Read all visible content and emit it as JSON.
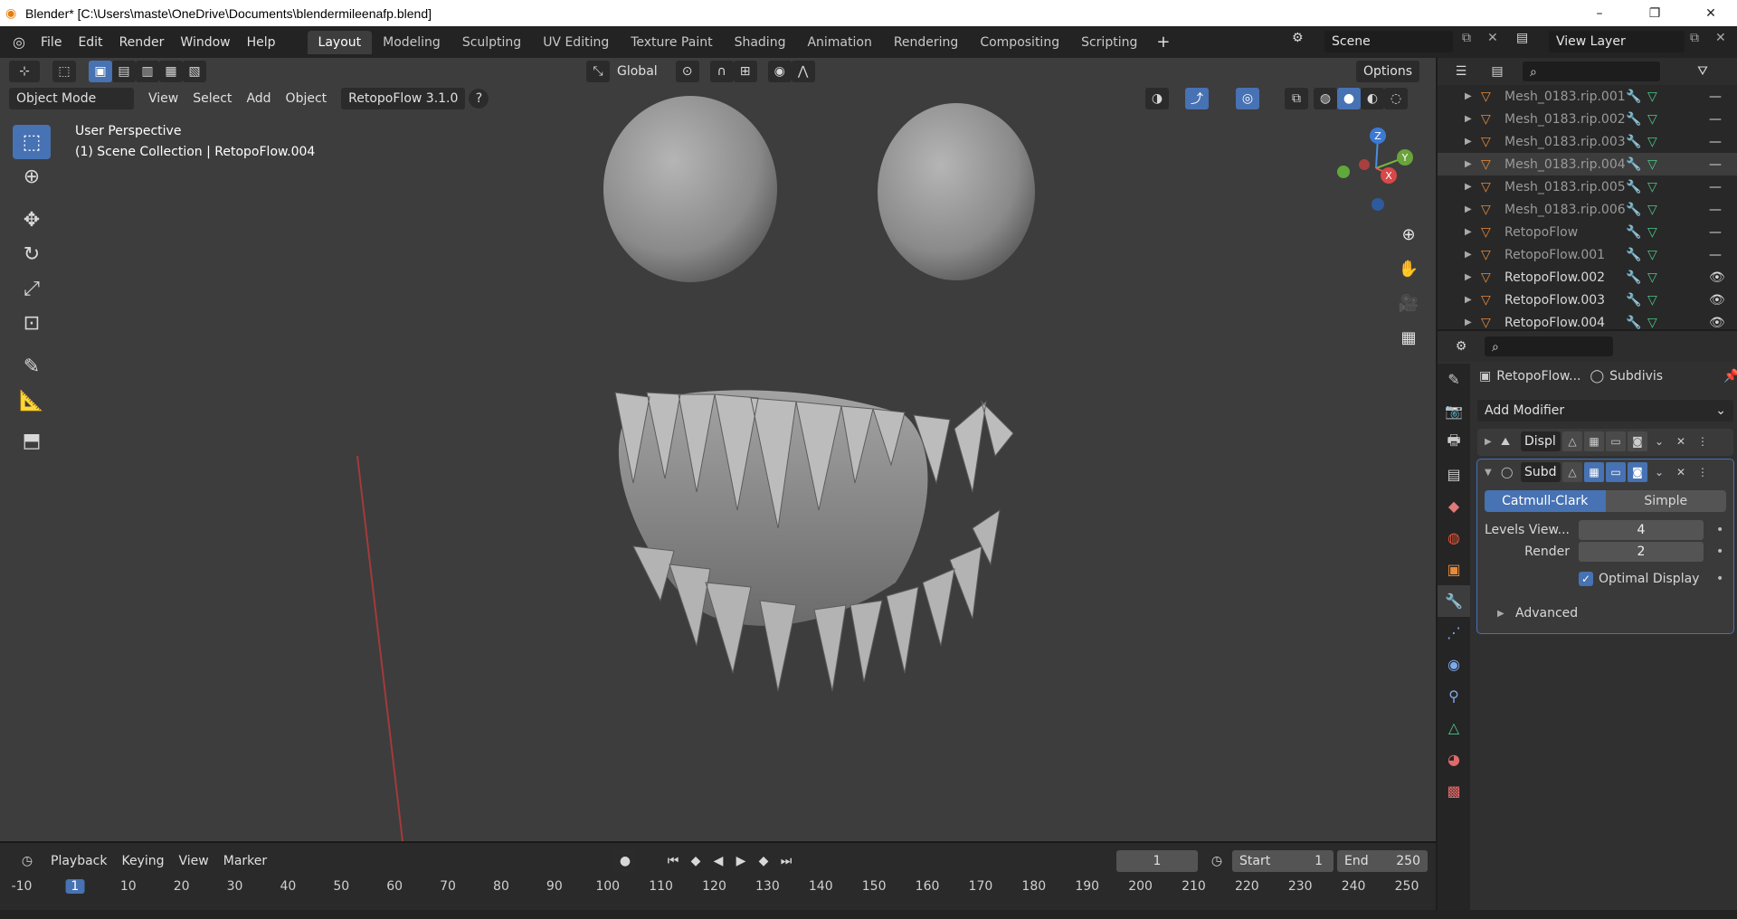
{
  "window": {
    "title": "Blender* [C:\\Users\\maste\\OneDrive\\Documents\\blendermileenafp.blend]",
    "controls": [
      "–",
      "❐",
      "✕"
    ]
  },
  "menubar": {
    "menus": [
      "File",
      "Edit",
      "Render",
      "Window",
      "Help"
    ],
    "workspaces": [
      "Layout",
      "Modeling",
      "Sculpting",
      "UV Editing",
      "Texture Paint",
      "Shading",
      "Animation",
      "Rendering",
      "Compositing",
      "Scripting"
    ],
    "active_workspace": "Layout",
    "add_tab": "+",
    "scene": "Scene",
    "view_layer": "View Layer"
  },
  "viewport": {
    "transform_orientation": "Global",
    "options_label": "Options",
    "mode": "Object Mode",
    "menus": [
      "View",
      "Select",
      "Add",
      "Object"
    ],
    "addon_label": "RetopoFlow 3.1.0",
    "help_glyph": "?",
    "perspective": "User Perspective",
    "collection_info": "(1) Scene Collection | RetopoFlow.004",
    "gizmo": {
      "z": "Z",
      "y": "Y",
      "x": "X"
    }
  },
  "outliner": {
    "items": [
      {
        "name": "Mesh_0183.rip.001",
        "dim": true,
        "eye": "—"
      },
      {
        "name": "Mesh_0183.rip.002",
        "dim": true,
        "eye": "—"
      },
      {
        "name": "Mesh_0183.rip.003",
        "dim": true,
        "eye": "—"
      },
      {
        "name": "Mesh_0183.rip.004",
        "dim": true,
        "eye": "—"
      },
      {
        "name": "Mesh_0183.rip.005",
        "dim": true,
        "eye": "—"
      },
      {
        "name": "Mesh_0183.rip.006",
        "dim": true,
        "eye": "—"
      },
      {
        "name": "RetopoFlow",
        "dim": true,
        "eye": "—"
      },
      {
        "name": "RetopoFlow.001",
        "dim": true,
        "eye": "—"
      },
      {
        "name": "RetopoFlow.002",
        "dim": false,
        "eye": "👁"
      },
      {
        "name": "RetopoFlow.003",
        "dim": false,
        "eye": "👁"
      },
      {
        "name": "RetopoFlow.004",
        "dim": false,
        "eye": "👁"
      }
    ]
  },
  "properties": {
    "object_name": "RetopoFlow...",
    "modifier_name": "Subdivis",
    "add_modifier": "Add Modifier",
    "modifiers": [
      {
        "name": "Displ",
        "expanded": false
      },
      {
        "name": "Subd",
        "expanded": true
      }
    ],
    "subdiv": {
      "types": [
        "Catmull-Clark",
        "Simple"
      ],
      "active_type": "Catmull-Clark",
      "levels_label": "Levels View...",
      "levels_value": "4",
      "render_label": "Render",
      "render_value": "2",
      "optimal_label": "Optimal Display",
      "optimal_checked": true,
      "advanced_label": "Advanced"
    }
  },
  "timeline": {
    "menus": [
      "Playback",
      "Keying",
      "View",
      "Marker"
    ],
    "current_frame": "1",
    "start_label": "Start",
    "start_value": "1",
    "end_label": "End",
    "end_value": "250",
    "ruler": [
      "-10",
      "1",
      "10",
      "20",
      "30",
      "40",
      "50",
      "60",
      "70",
      "80",
      "90",
      "100",
      "110",
      "120",
      "130",
      "140",
      "150",
      "160",
      "170",
      "180",
      "190",
      "200",
      "210",
      "220",
      "230",
      "240",
      "250"
    ]
  },
  "colors": {
    "accent": "#4772b3",
    "viewport_bg": "#3d3d3d",
    "panel_bg": "#303030",
    "object_orange": "#e88a3a"
  }
}
